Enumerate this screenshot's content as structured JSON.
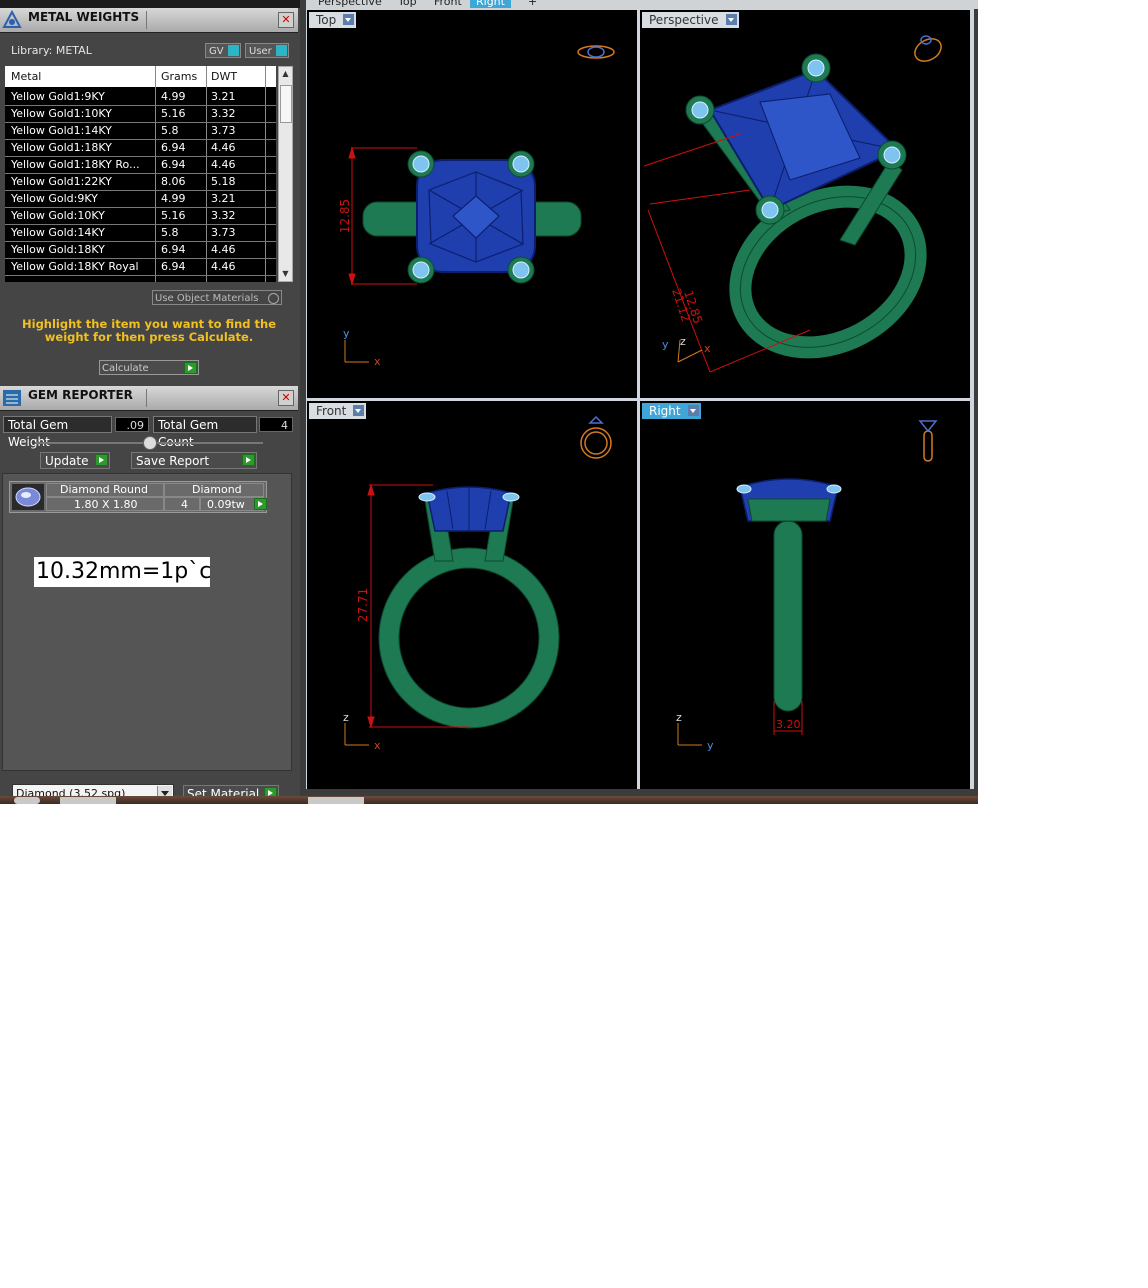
{
  "view_tabs": [
    "Perspective",
    "Top",
    "Front",
    "Right"
  ],
  "metal_panel": {
    "title": "METAL WEIGHTS",
    "library_label": "Library: METAL",
    "gv_label": "GV",
    "user_label": "User",
    "columns": [
      "Metal",
      "Grams",
      "DWT"
    ],
    "rows": [
      {
        "metal": "Yellow Gold1:9KY",
        "grams": "4.99",
        "dwt": "3.21"
      },
      {
        "metal": "Yellow Gold1:10KY",
        "grams": "5.16",
        "dwt": "3.32"
      },
      {
        "metal": "Yellow Gold1:14KY",
        "grams": "5.8",
        "dwt": "3.73"
      },
      {
        "metal": "Yellow Gold1:18KY",
        "grams": "6.94",
        "dwt": "4.46"
      },
      {
        "metal": "Yellow Gold1:18KY Ro...",
        "grams": "6.94",
        "dwt": "4.46"
      },
      {
        "metal": "Yellow Gold1:22KY",
        "grams": "8.06",
        "dwt": "5.18"
      },
      {
        "metal": "Yellow Gold:9KY",
        "grams": "4.99",
        "dwt": "3.21"
      },
      {
        "metal": "Yellow Gold:10KY",
        "grams": "5.16",
        "dwt": "3.32"
      },
      {
        "metal": "Yellow Gold:14KY",
        "grams": "5.8",
        "dwt": "3.73"
      },
      {
        "metal": "Yellow Gold:18KY",
        "grams": "6.94",
        "dwt": "4.46"
      },
      {
        "metal": "Yellow Gold:18KY Royal",
        "grams": "6.94",
        "dwt": "4.46"
      }
    ],
    "use_object_materials": "Use Object Materials",
    "hint": "Highlight the item you want to find the weight for then press Calculate.",
    "calculate_label": "Calculate"
  },
  "gem_panel": {
    "title": "GEM REPORTER",
    "total_weight_label": "Total Gem Weight",
    "total_weight_value": ".09",
    "total_count_label": "Total Gem Count",
    "total_count_value": "4",
    "update_label": "Update",
    "save_report_label": "Save Report",
    "gem": {
      "cut": "Diamond Round",
      "material": "Diamond",
      "size": "1.80 X 1.80",
      "count": "4",
      "weight": "0.09tw"
    },
    "note": "10.32mm=1p`c",
    "material_select": "Diamond     (3.52 spg)",
    "set_material_label": "Set Material"
  },
  "viewports": {
    "top": {
      "label": "Top",
      "dimension": "12.85",
      "axis_v": "y",
      "axis_h": "x"
    },
    "perspective": {
      "label": "Perspective",
      "dimension1": "21.12",
      "dimension2": "12.85",
      "axis_y": "y",
      "axis_z": "z",
      "axis_x": "x"
    },
    "front": {
      "label": "Front",
      "dimension": "27.71",
      "axis_v": "z",
      "axis_h": "x"
    },
    "right": {
      "label": "Right",
      "dimension": "3.20",
      "axis_v": "z",
      "axis_h": "y"
    }
  },
  "colors": {
    "metal": "#1d7a52",
    "gem": "#1f3fae",
    "prong_gem": "#7fc4f0",
    "dimension": "#cc1111",
    "tab_active": "#3fa6d8",
    "hint": "#f0c020"
  }
}
